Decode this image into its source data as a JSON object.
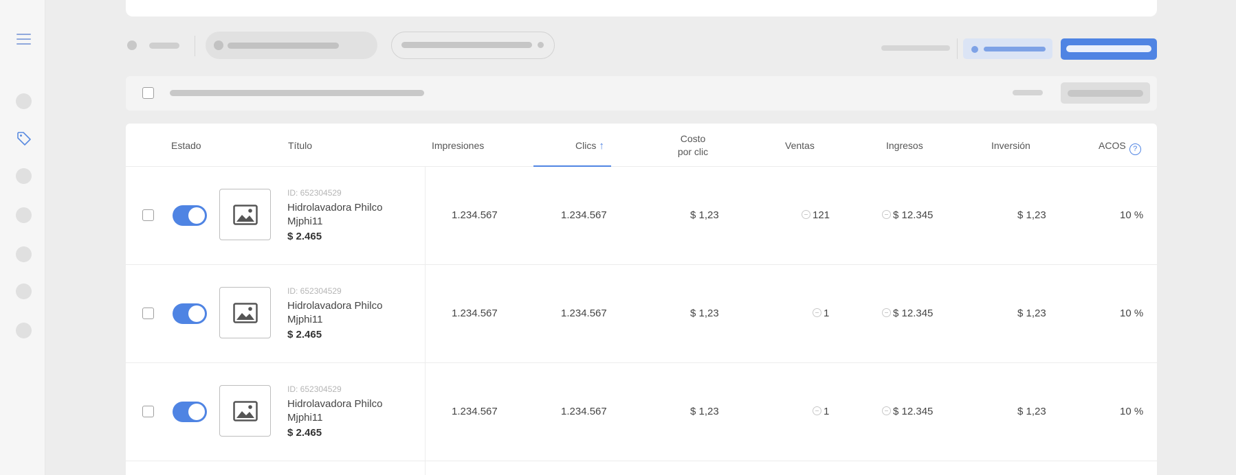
{
  "colors": {
    "accent": "#4f84e3",
    "background": "#ededed"
  },
  "sidebar": {
    "icons": [
      "menu-icon",
      "tag-icon"
    ]
  },
  "table": {
    "columns": {
      "estado": "Estado",
      "titulo": "Título",
      "impresiones": "Impresiones",
      "clics": "Clics",
      "costo_line1": "Costo",
      "costo_line2": "por clic",
      "ventas": "Ventas",
      "ingresos": "Ingresos",
      "inversion": "Inversión",
      "acos": "ACOS"
    },
    "sort_column": "clics",
    "sort_direction": "ascending",
    "rows": [
      {
        "id": "ID: 652304529",
        "title": "Hidrolavadora Philco Mjphi11",
        "price": "$ 2.465",
        "active": true,
        "impresiones": "1.234.567",
        "clics": "1.234.567",
        "costo": "$ 1,23",
        "ventas": "121",
        "ingresos": "$ 12.345",
        "inversion": "$ 1,23",
        "acos": "10 %"
      },
      {
        "id": "ID: 652304529",
        "title": "Hidrolavadora Philco Mjphi11",
        "price": "$ 2.465",
        "active": true,
        "impresiones": "1.234.567",
        "clics": "1.234.567",
        "costo": "$ 1,23",
        "ventas": "1",
        "ingresos": "$ 12.345",
        "inversion": "$ 1,23",
        "acos": "10 %"
      },
      {
        "id": "ID: 652304529",
        "title": "Hidrolavadora Philco Mjphi11",
        "price": "$ 2.465",
        "active": true,
        "impresiones": "1.234.567",
        "clics": "1.234.567",
        "costo": "$ 1,23",
        "ventas": "1",
        "ingresos": "$ 12.345",
        "inversion": "$ 1,23",
        "acos": "10 %"
      }
    ]
  }
}
